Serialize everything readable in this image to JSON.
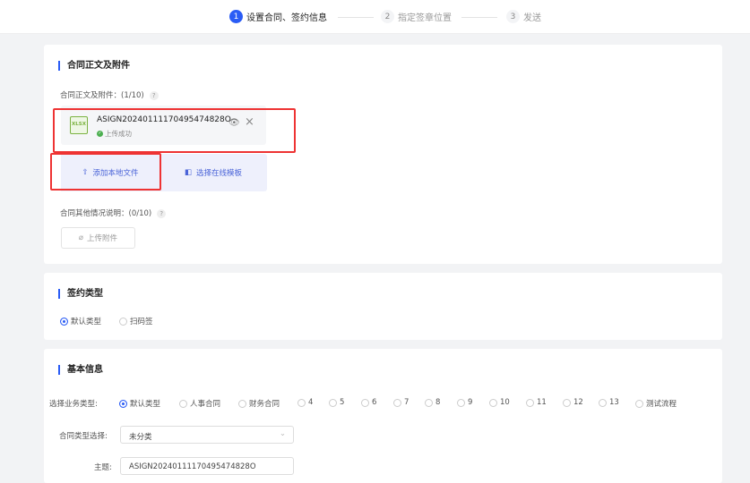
{
  "steps": [
    {
      "num": "1",
      "label": "设置合同、签约信息"
    },
    {
      "num": "2",
      "label": "指定签章位置"
    },
    {
      "num": "3",
      "label": "发送"
    }
  ],
  "section1": {
    "title": "合同正文及附件",
    "files_label": "合同正文及附件：(1/10)",
    "help": "?",
    "file": {
      "icon": "XLSX",
      "name": "ASIGN20240111170495474828O",
      "status": "上传成功"
    },
    "add_local": "添加本地文件",
    "choose_template": "选择在线模板",
    "other_label": "合同其他情况说明：(0/10)",
    "upload_attachment": "上传附件"
  },
  "section2": {
    "title": "签约类型",
    "options": [
      "默认类型",
      "扫码签"
    ],
    "selected": 0
  },
  "section3": {
    "title": "基本信息",
    "biz_label": "选择业务类型:",
    "biz_options": [
      "默认类型",
      "人事合同",
      "财务合同",
      "4",
      "5",
      "6",
      "7",
      "8",
      "9",
      "10",
      "11",
      "12",
      "13",
      "测试流程"
    ],
    "biz_selected": 0,
    "contract_type_label": "合同类型选择:",
    "contract_type_value": "未分类",
    "subject_label": "主题:",
    "subject_value": "ASIGN20240111170495474828O"
  },
  "colors": {
    "accent": "#2a5cf5",
    "highlight": "#e33333"
  }
}
